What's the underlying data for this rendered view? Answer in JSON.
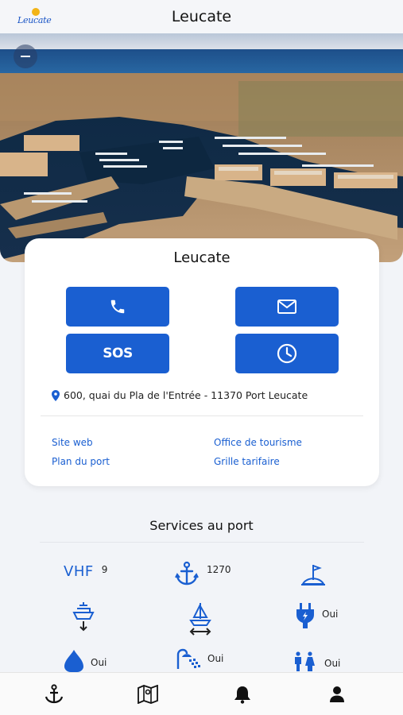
{
  "header": {
    "title": "Leucate",
    "logo_text": "Leucate",
    "back_icon": "back-arrow-icon"
  },
  "port": {
    "name": "Leucate",
    "address": "600, quai du Pla de l'Entrée - 11370 Port Leucate"
  },
  "actions": {
    "sos_label": "SOS",
    "icons": [
      "phone-icon",
      "mail-icon",
      "clock-icon"
    ]
  },
  "links": {
    "website": "Site web",
    "tourism": "Office de tourisme",
    "port_plan": "Plan du port",
    "rates": "Grille tarifaire"
  },
  "services": {
    "title": "Services au port",
    "vhf_label": "VHF",
    "vhf_channel": "9",
    "moorings": "1270",
    "electricity": "Oui",
    "fuel": "Oui",
    "showers": "Oui",
    "toilets": "Oui"
  },
  "tabs": [
    "anchor-icon",
    "map-icon",
    "bell-icon",
    "user-icon"
  ],
  "colors": {
    "accent": "#1a5fd1",
    "background": "#f2f4f8"
  }
}
